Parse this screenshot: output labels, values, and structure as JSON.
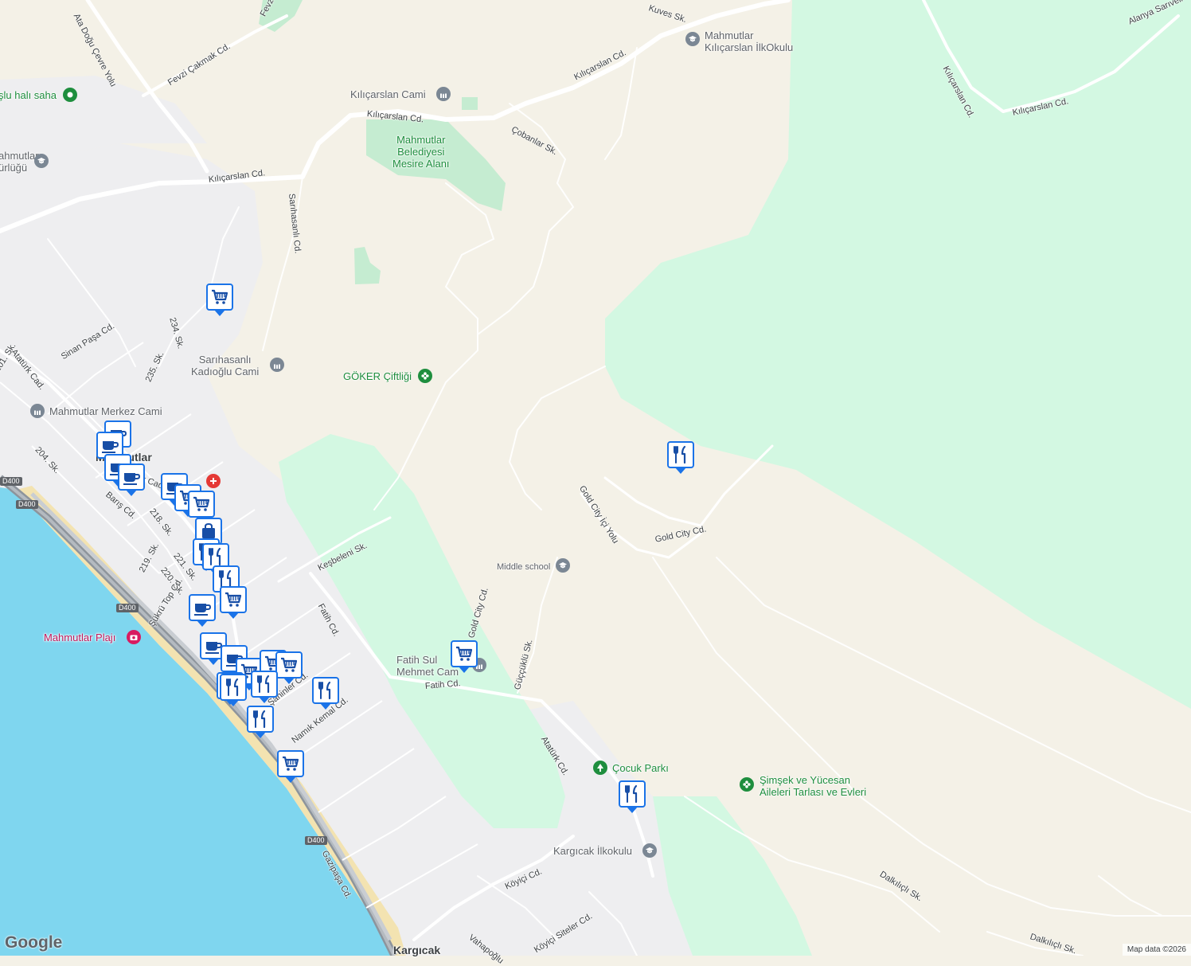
{
  "map": {
    "colors": {
      "land": "#f4f1e7",
      "urban": "#eeeef0",
      "park": "#cfeed8",
      "forest": "#d3f8e2",
      "water": "#7fd6ef",
      "road": "#ffffff",
      "highway": "#9aa0a6",
      "beach": "#f3e3b1"
    }
  },
  "pois": [
    {
      "name": "Mahmutlar Kılıçarslan İlkOkulu",
      "line1": "Mahmutlar",
      "line2": "Kılıçarslan İlkOkulu",
      "kind": "school",
      "color": "gray"
    },
    {
      "name": "Kılıçarslan Cami",
      "kind": "mosque",
      "color": "gray"
    },
    {
      "name": "Mahmutlar Belediyesi Mesire Alanı",
      "line1": "Mahmutlar",
      "line2": "Belediyesi",
      "line3": "Mesire Alanı",
      "kind": "park",
      "color": "green"
    },
    {
      "name": "Sarıhasanlı Kadıoğlu Cami",
      "line1": "Sarıhasanlı",
      "line2": "Kadıoğlu Cami",
      "kind": "mosque",
      "color": "gray"
    },
    {
      "name": "GÖKER Çiftliği",
      "kind": "farm",
      "color": "green"
    },
    {
      "name": "Mahmutlar Merkez Cami",
      "kind": "mosque",
      "color": "gray"
    },
    {
      "name": "Middle school",
      "kind": "school",
      "color": "gray"
    },
    {
      "name": "Fatih Sultan Mehmet Cami",
      "line1": "Fatih Sul",
      "line2": "Mehmet Cam",
      "kind": "mosque",
      "color": "gray"
    },
    {
      "name": "Çocuk Parkı",
      "kind": "park",
      "color": "green"
    },
    {
      "name": "Şimşek ve Yücesan Aileleri Tarlası ve Evleri",
      "line1": "Şimşek ve Yücesan",
      "line2": "Aileleri Tarlası ve Evleri",
      "kind": "farm",
      "color": "green"
    },
    {
      "name": "Kargıcak İlkokulu",
      "kind": "school",
      "color": "gray"
    },
    {
      "name": "Mahmutlar Plajı",
      "kind": "beach",
      "color": "pink"
    },
    {
      "name": "şlu halı saha",
      "kind": "sports",
      "color": "green"
    },
    {
      "name": "Mahmutlar ...ürlüğü",
      "line1": "ahmutlar",
      "line2": "ürlüğü",
      "kind": "school",
      "color": "gray"
    },
    {
      "name": "Mahmutlar",
      "kind": "town",
      "color": "dark"
    },
    {
      "name": "Kargıcak",
      "kind": "town",
      "color": "dark"
    }
  ],
  "streets": [
    "Kılıçarslan Cd.",
    "Kılıçarslan Cd.",
    "Kılıçarslan Cd.",
    "Kılıçarslan Cd.",
    "Kılıçarslan Cd.",
    "Çobanlar Sk.",
    "Sarıhasanlı Cd.",
    "Fevzi Çakmak Cd.",
    "Alanya Sarıveli",
    "Kuves Sk.",
    "Sinan Paşa Cd.",
    "234. Sk.",
    "235. Sk.",
    "Atatürk Cad.",
    "201. Sk.",
    "204. Sk.",
    "Barış Cd.",
    "218. Sk.",
    "219. Sk.",
    "220. Sk.",
    "221. Sk.",
    "Şükrü Top Cd.",
    "Keşbeleni Sk.",
    "Fatih Cd.",
    "Fatih Cd.",
    "Gold City Cd.",
    "Gold City İçi Yolu",
    "Gold City Cd.",
    "Güççüklü Sk.",
    "Atatürk Cd.",
    "Namık Kemal Cd.",
    "Şahinler Cd.",
    "Gazipaşa Cd.",
    "Köyiçi Cd.",
    "Vahapoğlu",
    "Köyiçi Siteler Cd.",
    "Dalkılıçlı Sk.",
    "Dalkılıçlı Sk.",
    "Ata Doğu Çevre Yolu",
    "Fevzi",
    "Atatürk Cad."
  ],
  "shields": [
    "D400",
    "D400",
    "D400",
    "D400"
  ],
  "markers": [
    {
      "type": "shopping-cart"
    },
    {
      "type": "coffee"
    },
    {
      "type": "coffee"
    },
    {
      "type": "coffee"
    },
    {
      "type": "coffee"
    },
    {
      "type": "coffee"
    },
    {
      "type": "shopping-cart"
    },
    {
      "type": "shopping-cart"
    },
    {
      "type": "shopping-bag"
    },
    {
      "type": "restaurant"
    },
    {
      "type": "restaurant"
    },
    {
      "type": "restaurant"
    },
    {
      "type": "shopping-cart"
    },
    {
      "type": "coffee"
    },
    {
      "type": "coffee"
    },
    {
      "type": "coffee"
    },
    {
      "type": "shopping-cart"
    },
    {
      "type": "shopping-cart"
    },
    {
      "type": "shopping-cart"
    },
    {
      "type": "restaurant"
    },
    {
      "type": "restaurant"
    },
    {
      "type": "restaurant"
    },
    {
      "type": "restaurant"
    },
    {
      "type": "restaurant"
    },
    {
      "type": "shopping-cart"
    },
    {
      "type": "shopping-cart"
    },
    {
      "type": "restaurant"
    }
  ],
  "branding": {
    "logo": "Google",
    "attribution": "Map data ©2026"
  }
}
